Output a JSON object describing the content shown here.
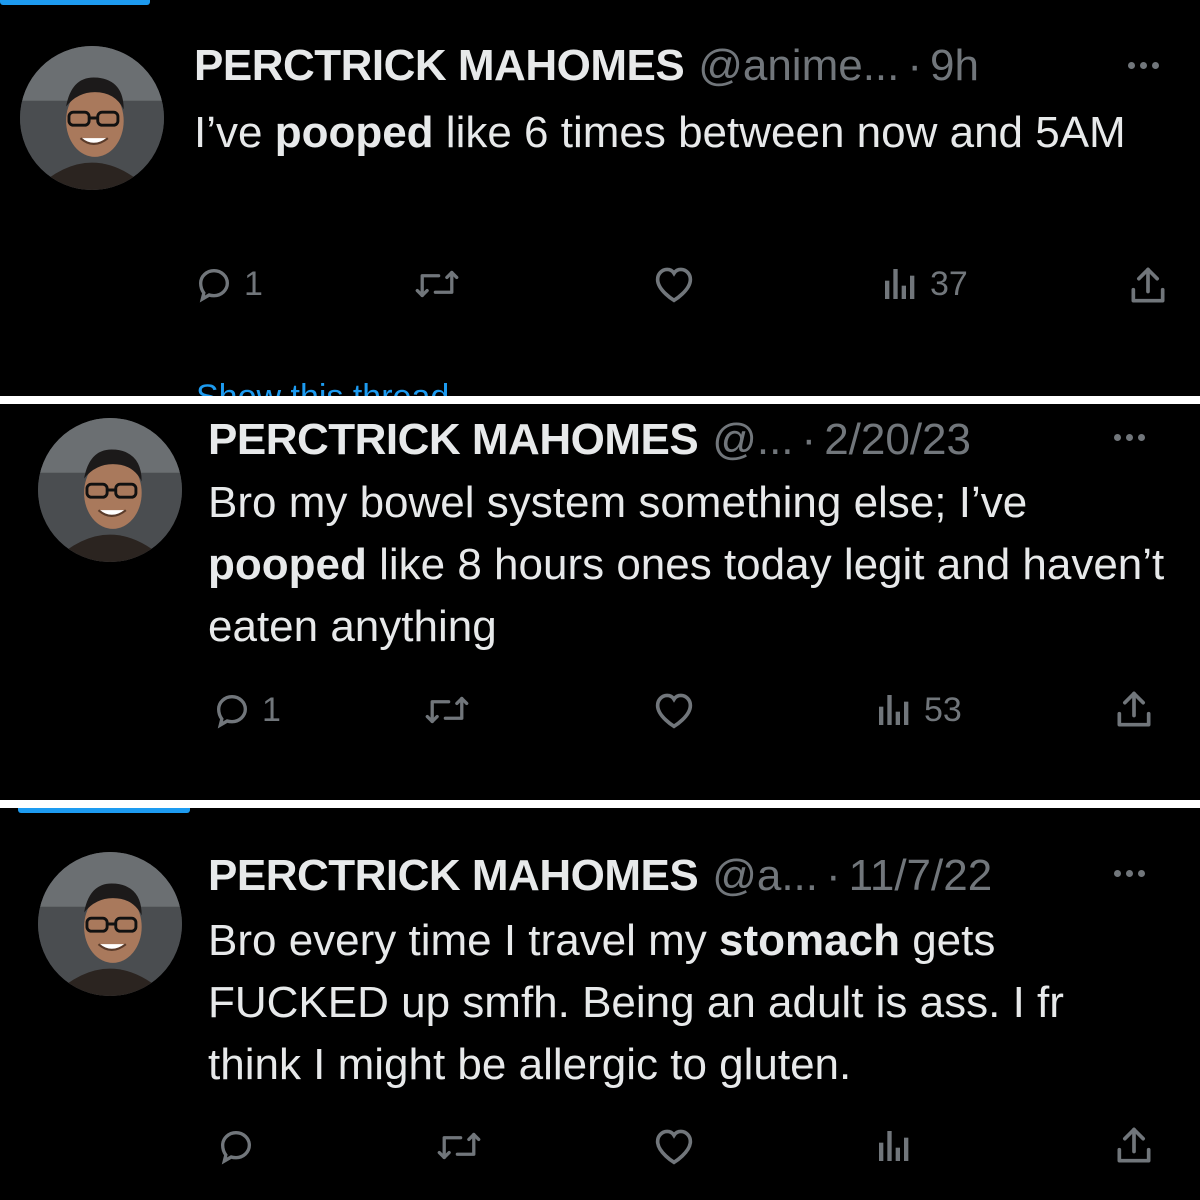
{
  "tweets": [
    {
      "display_name": "PERCTRICK MAHOMES",
      "handle": "@anime...",
      "separator": "·",
      "time": "9h",
      "text_before": "I’ve ",
      "bold": "pooped",
      "text_after": " like 6 times between now and 5AM",
      "replies": "1",
      "views": "37"
    },
    {
      "display_name": "PERCTRICK MAHOMES",
      "handle": "@...",
      "separator": "·",
      "time": "2/20/23",
      "text_before": "Bro my bowel system something else; I’ve ",
      "bold": "pooped",
      "text_after": " like 8 hours ones today legit and haven’t eaten anything",
      "replies": "1",
      "views": "53"
    },
    {
      "display_name": "PERCTRICK MAHOMES",
      "handle": "@a...",
      "separator": "·",
      "time": "11/7/22",
      "text_before": "Bro every time I travel my ",
      "bold": "stomach",
      "text_after": " gets FUCKED up smfh. Being an adult is ass. I fr think I might be allergic to gluten.",
      "replies": "",
      "views": ""
    }
  ],
  "thread_link": "Show this thread",
  "colors": {
    "background": "#000000",
    "text": "#e7e9ea",
    "secondary": "#71767b",
    "accent": "#1d9bf0",
    "divider": "#ffffff"
  },
  "icons": [
    "reply-icon",
    "retweet-icon",
    "like-icon",
    "views-icon",
    "share-icon",
    "more-icon"
  ]
}
